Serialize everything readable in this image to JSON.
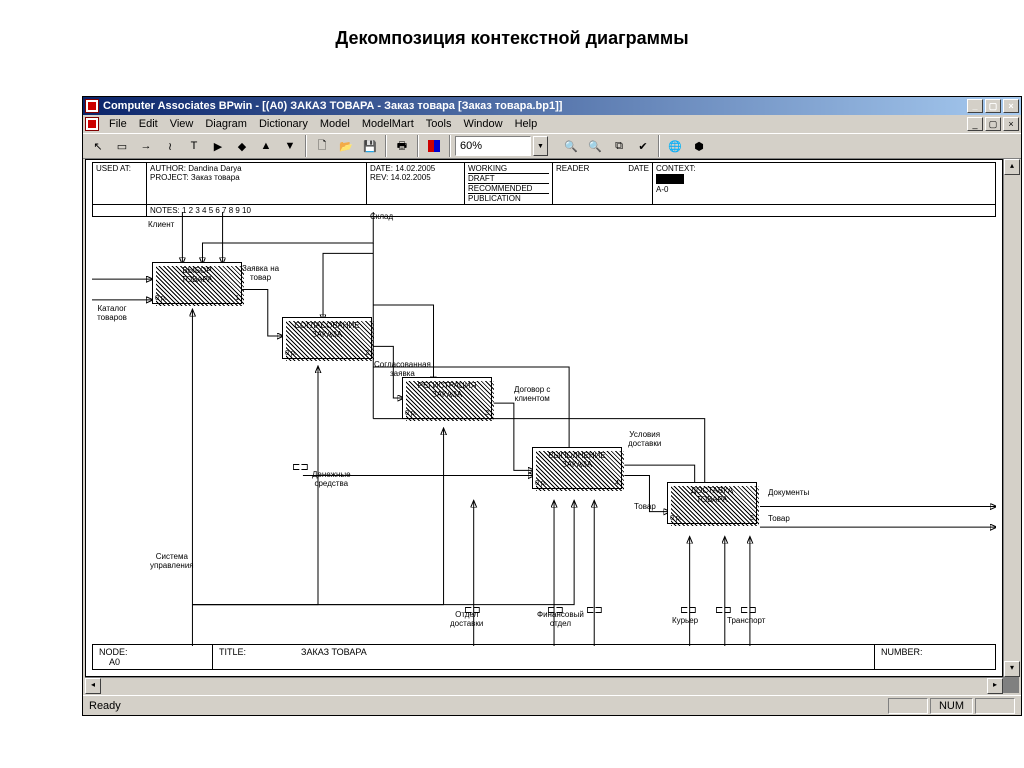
{
  "page_title": "Декомпозиция контекстной диаграммы",
  "window": {
    "title": "Computer Associates BPwin - [(A0) ЗАКАЗ ТОВАРА  - Заказ товара  [Заказ товара.bp1]]",
    "buttons": {
      "min": "_",
      "max": "▢",
      "close": "×"
    }
  },
  "menu": [
    "File",
    "Edit",
    "View",
    "Diagram",
    "Dictionary",
    "Model",
    "ModelMart",
    "Tools",
    "Window",
    "Help"
  ],
  "toolbar": {
    "zoom": "60%"
  },
  "info": {
    "used_at": "USED AT:",
    "author_label": "AUTHOR:",
    "author": "Dandina Darya",
    "project_label": "PROJECT:",
    "project": "Заказ товара",
    "date_label": "DATE:",
    "date": "14.02.2005",
    "rev_label": "REV:",
    "rev": "14.02.2005",
    "working": "WORKING",
    "draft": "DRAFT",
    "recommended": "RECOMMENDED",
    "publication": "PUBLICATION",
    "reader": "READER",
    "date2": "DATE",
    "context": "CONTEXT:",
    "context_node": "A-0",
    "notes": "NOTES:  1  2  3  4  5  6  7  8  9  10"
  },
  "footer": {
    "node_label": "NODE:",
    "node": "A0",
    "title_label": "TITLE:",
    "title": "ЗАКАЗ ТОВАРА",
    "number_label": "NUMBER:"
  },
  "activities": [
    {
      "id": 1,
      "name": "ВЫБОР\nТОВАРА",
      "cost": "0 р.",
      "num": "1"
    },
    {
      "id": 2,
      "name": "СОГЛАСОВАНИЕ\nЗАКАЗА",
      "cost": "0 р.",
      "num": "2"
    },
    {
      "id": 3,
      "name": "РЕГИСТРАЦИЯ\nЗАКАЗА",
      "cost": "0 р.",
      "num": "3"
    },
    {
      "id": 4,
      "name": "ВЫПОЛНЕНИЕ\nЗАКАЗА",
      "cost": "0 р.",
      "num": "4"
    },
    {
      "id": 5,
      "name": "ДОСТАВКА\nТОВАРА",
      "cost": "0 р.",
      "num": "5"
    }
  ],
  "labels": {
    "klient": "Клиент",
    "sklad": "Склад",
    "katalog": "Каталог\nтоваров",
    "zayavka": "Заявка на\nтовар",
    "soglas_zayavka": "Согласованная\nзаявка",
    "dogovor": "Договор с\nклиентом",
    "usloviya": "Условия\nдоставки",
    "tovar1": "Товар",
    "tovar2": "Товар",
    "dokumenty": "Документы",
    "denezh": "Денежные\nсредства",
    "sistema": "Система\nуправления",
    "otdel": "Отдел\nдоставки",
    "fin_otdel": "Финансовый\nотдел",
    "kuryer": "Курьер",
    "transport": "Транспорт"
  },
  "status": {
    "ready": "Ready",
    "num": "NUM"
  }
}
